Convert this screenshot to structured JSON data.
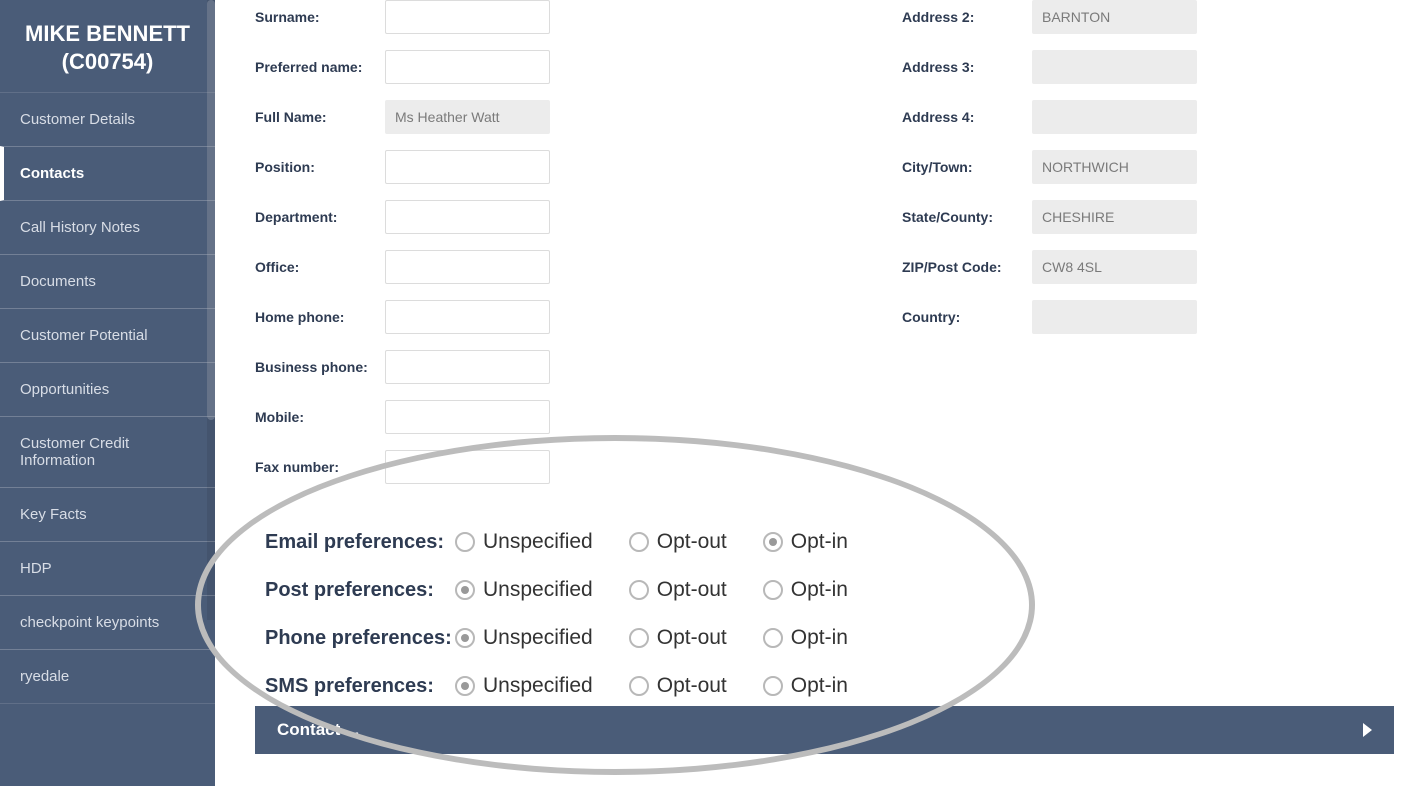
{
  "sidebar": {
    "title": "MIKE BENNETT (C00754)",
    "items": [
      {
        "label": "Customer Details",
        "active": false
      },
      {
        "label": "Contacts",
        "active": true
      },
      {
        "label": "Call History Notes",
        "active": false
      },
      {
        "label": "Documents",
        "active": false
      },
      {
        "label": "Customer Potential",
        "active": false
      },
      {
        "label": "Opportunities",
        "active": false
      },
      {
        "label": "Customer Credit Information",
        "active": false
      },
      {
        "label": "Key Facts",
        "active": false
      },
      {
        "label": "HDP",
        "active": false
      },
      {
        "label": "checkpoint keypoints",
        "active": false
      },
      {
        "label": "ryedale",
        "active": false
      }
    ]
  },
  "left_fields": [
    {
      "label": "Surname:",
      "value": "",
      "readonly": false,
      "name": "surname-field"
    },
    {
      "label": "Preferred name:",
      "value": "",
      "readonly": false,
      "name": "preferred-name-field"
    },
    {
      "label": "Full Name:",
      "value": "Ms Heather Watt",
      "readonly": true,
      "name": "full-name-field"
    },
    {
      "label": "Position:",
      "value": "",
      "readonly": false,
      "name": "position-field"
    },
    {
      "label": "Department:",
      "value": "",
      "readonly": false,
      "name": "department-field"
    },
    {
      "label": "Office:",
      "value": "",
      "readonly": false,
      "name": "office-field"
    },
    {
      "label": "Home phone:",
      "value": "",
      "readonly": false,
      "name": "home-phone-field"
    },
    {
      "label": "Business phone:",
      "value": "",
      "readonly": false,
      "name": "business-phone-field"
    },
    {
      "label": "Mobile:",
      "value": "",
      "readonly": false,
      "name": "mobile-field"
    },
    {
      "label": "Fax number:",
      "value": "",
      "readonly": false,
      "name": "fax-number-field"
    }
  ],
  "right_fields": [
    {
      "label": "Address 2:",
      "value": "BARNTON",
      "readonly": true,
      "name": "address-2-field"
    },
    {
      "label": "Address 3:",
      "value": "",
      "readonly": true,
      "name": "address-3-field"
    },
    {
      "label": "Address 4:",
      "value": "",
      "readonly": true,
      "name": "address-4-field"
    },
    {
      "label": "City/Town:",
      "value": "NORTHWICH",
      "readonly": true,
      "name": "city-town-field"
    },
    {
      "label": "State/County:",
      "value": "CHESHIRE",
      "readonly": true,
      "name": "state-county-field"
    },
    {
      "label": "ZIP/Post Code:",
      "value": "CW8 4SL",
      "readonly": true,
      "name": "zip-post-code-field"
    },
    {
      "label": "Country:",
      "value": "",
      "readonly": true,
      "name": "country-field"
    }
  ],
  "preferences": {
    "options": [
      "Unspecified",
      "Opt-out",
      "Opt-in"
    ],
    "rows": [
      {
        "label": "Email preferences:",
        "selected": 2,
        "name": "email-preferences"
      },
      {
        "label": "Post preferences:",
        "selected": 0,
        "name": "post-preferences"
      },
      {
        "label": "Phone preferences:",
        "selected": 0,
        "name": "phone-preferences"
      },
      {
        "label": "SMS preferences:",
        "selected": 0,
        "name": "sms-preferences"
      }
    ]
  },
  "contact_bar": {
    "label": "Contact ..."
  }
}
